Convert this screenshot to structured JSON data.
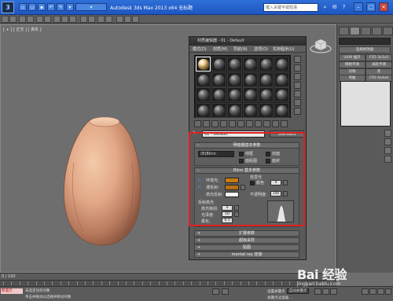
{
  "app": {
    "logo_text": "3",
    "title": "Autodesk 3ds Max 2013 x64   无标题",
    "search_placeholder": "键入关键字或短语"
  },
  "viewport": {
    "label": "[ + ] [ 正交 ] [ 真实 ]"
  },
  "command_panel": {
    "object_field": "",
    "rows": [
      "选择修改器",
      "UVW 展开",
      "FFD 3x3x3",
      "网格平滑",
      "涡轮平滑",
      "对称",
      "壳",
      "弯曲",
      "FFD 4x4x4",
      "FFD 2x2x2"
    ]
  },
  "material_editor": {
    "title": "材质编辑器 - 01 - Default",
    "menu": [
      "模式(D)",
      "材质(M)",
      "导航(N)",
      "选项(O)",
      "实用程序(U)"
    ],
    "selected_slot_index": 0,
    "material_name": "01 - Default",
    "material_type": "Standard",
    "basic_params": {
      "header": "明暗器基本参数",
      "shader": "(B)Blinn",
      "wire": "线框",
      "two_sided": "双面",
      "face_map": "面贴图",
      "faceted": "面状"
    },
    "blinn_params": {
      "header": "Blinn 基本参数",
      "self_illum_title": "自发光",
      "self_illum_color": "颜色",
      "self_illum_value": "0",
      "ambient": "环境光:",
      "diffuse": "漫反射:",
      "specular": "高光反射:",
      "ambient_color": "#c77a12",
      "diffuse_color": "#b87014",
      "specular_color": "#f2f2f2",
      "opacity_label": "不透明度:",
      "opacity_value": "100",
      "lock_label": "L",
      "specular_highlights": "反射高光",
      "specular_level": "高光级别:",
      "specular_level_value": "0",
      "glossiness": "光泽度:",
      "glossiness_value": "10",
      "soften": "柔化:",
      "soften_value": "0.1"
    },
    "rollouts": [
      "扩展参数",
      "超级采样",
      "贴图",
      "mental ray 连接"
    ]
  },
  "timeline": {
    "frame": "0 / 100"
  },
  "status": {
    "listener": "所选行",
    "line1": "未选定任何对象",
    "line2": "单击并拖动以选择并移动对象",
    "auto_key": "自动关键点",
    "set_key": "设置关键点",
    "filter": "关键点过滤器..."
  },
  "watermark": {
    "main": "Bai 经验",
    "sub": "jingyan.baidu.com"
  },
  "colors": {
    "highlight_box": "#e02020",
    "title_bar": "#2e6fd8"
  }
}
